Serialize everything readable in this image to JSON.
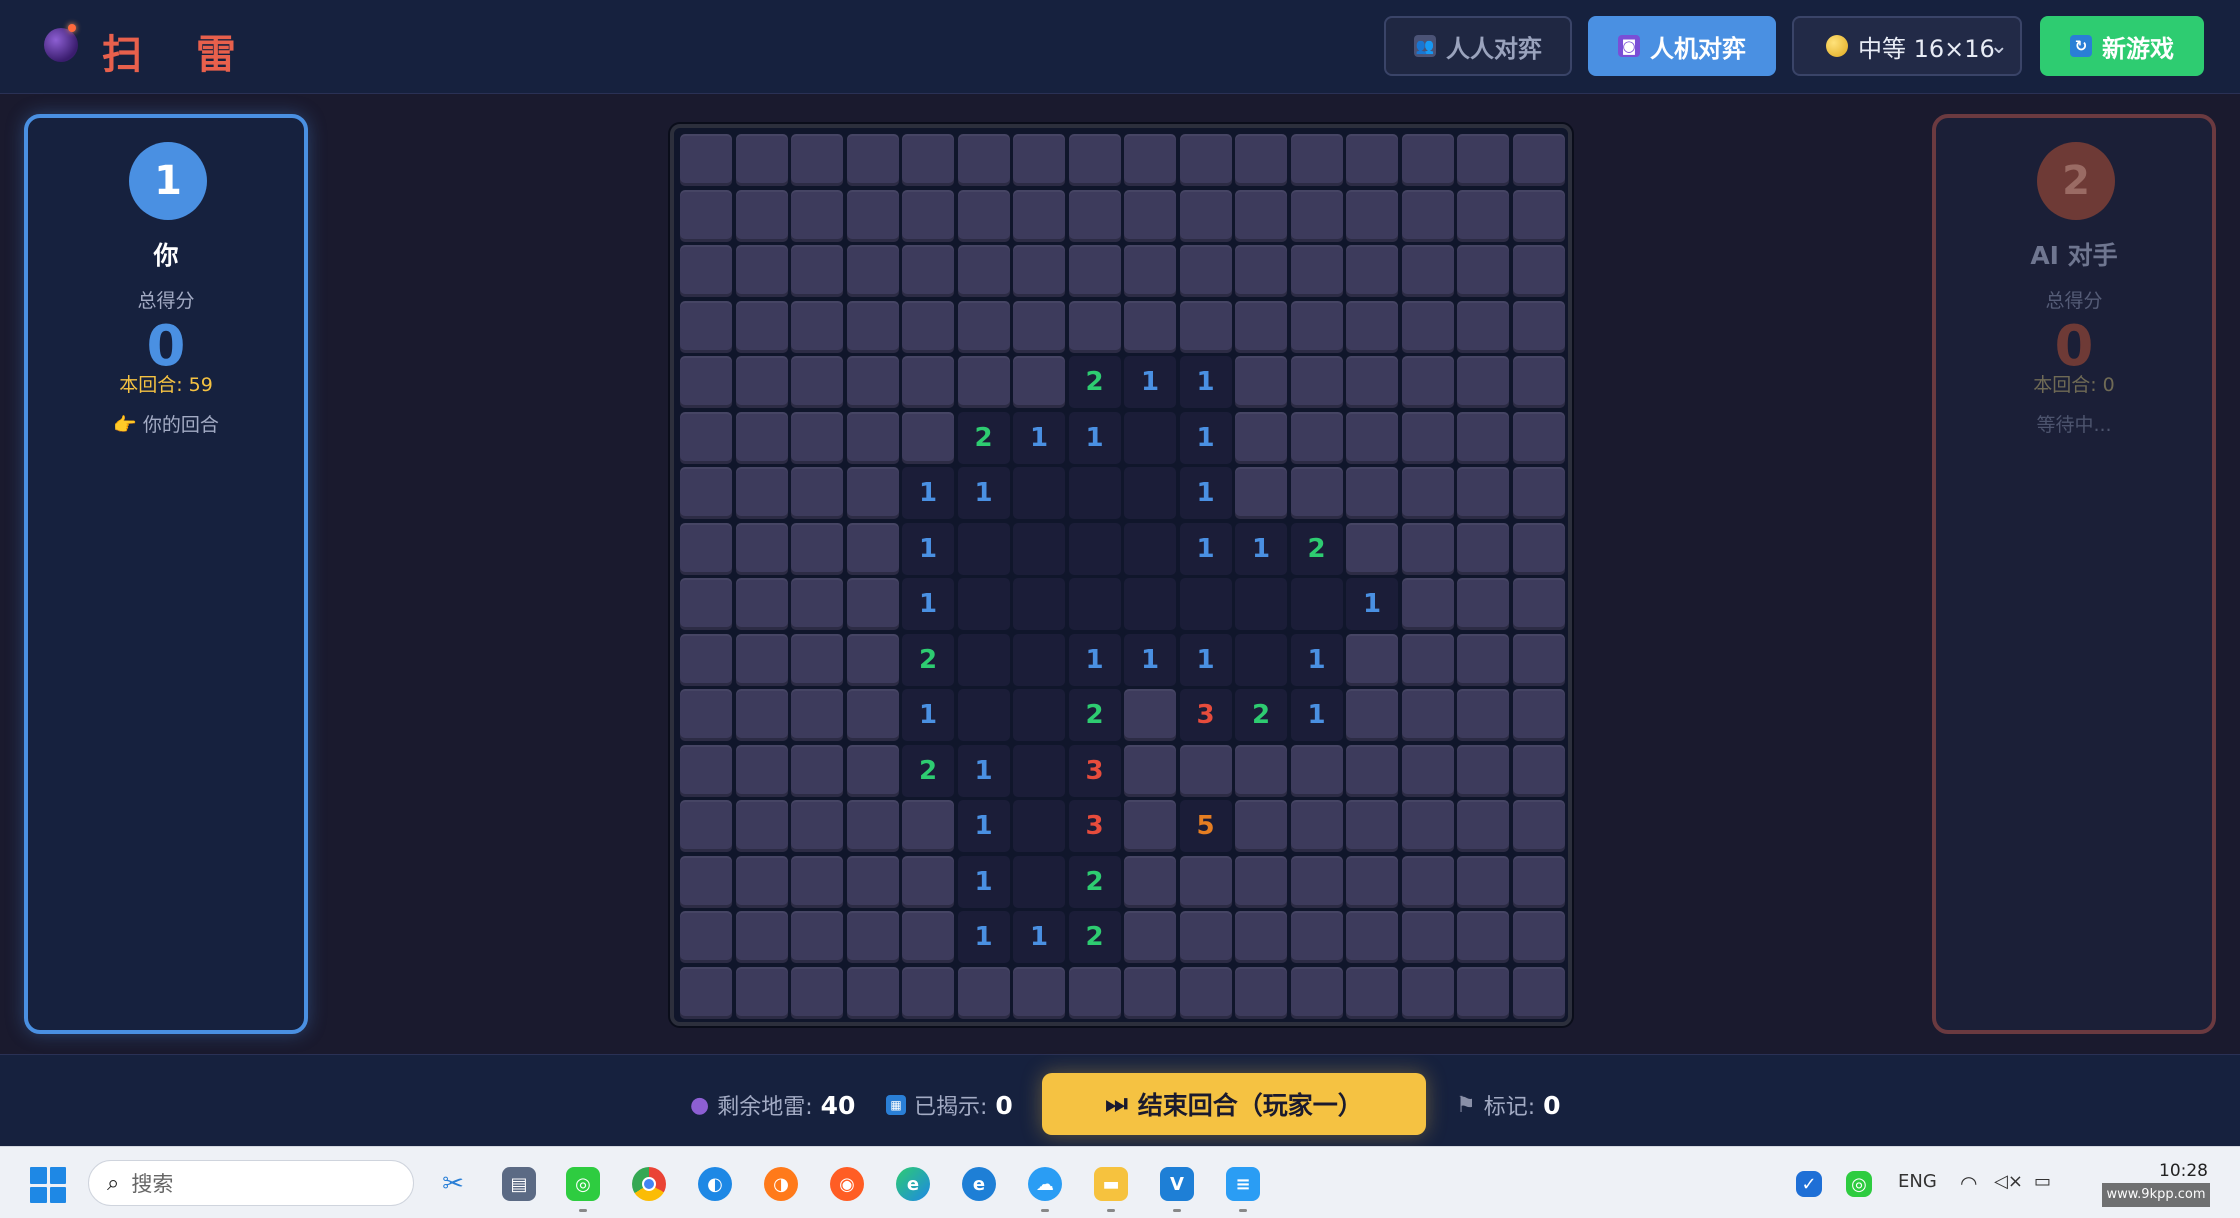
{
  "header": {
    "title": "扫 雷",
    "btn_pvp": "人人对弈",
    "btn_pve": "人机对弈",
    "difficulty": "中等 16×16",
    "btn_new": "新游戏"
  },
  "player1": {
    "number": "1",
    "name": "你",
    "score_label": "总得分",
    "score": "0",
    "round": "本回合: 59",
    "status": "你的回合"
  },
  "player2": {
    "number": "2",
    "name": "AI 对手",
    "score_label": "总得分",
    "score": "0",
    "round": "本回合: 0",
    "status": "等待中..."
  },
  "board": {
    "size": 16,
    "rows": [
      "################",
      "################",
      "################",
      "################",
      "#######211######",
      "#####211.1######",
      "####11...1######",
      "####1....112####",
      "####1.......1####",
      "####2..111.1####",
      "####1..2#321####",
      "####21.3########",
      "#####1.3#5######",
      "#####1.2########",
      "#####112########",
      "################"
    ]
  },
  "footer": {
    "mines_label": "剩余地雷:",
    "mines": "40",
    "revealed_label": "已揭示:",
    "revealed": "0",
    "end_turn": "结束回合（玩家一）",
    "flags_label": "标记:",
    "flags": "0"
  },
  "taskbar": {
    "search_placeholder": "搜索",
    "lang": "ENG",
    "time": "10:28",
    "watermark": "www.9kpp.com"
  },
  "colors": {
    "accent": "#4a90e2",
    "success": "#2ecc71",
    "warning": "#f5c242",
    "danger": "#e74c3c"
  }
}
